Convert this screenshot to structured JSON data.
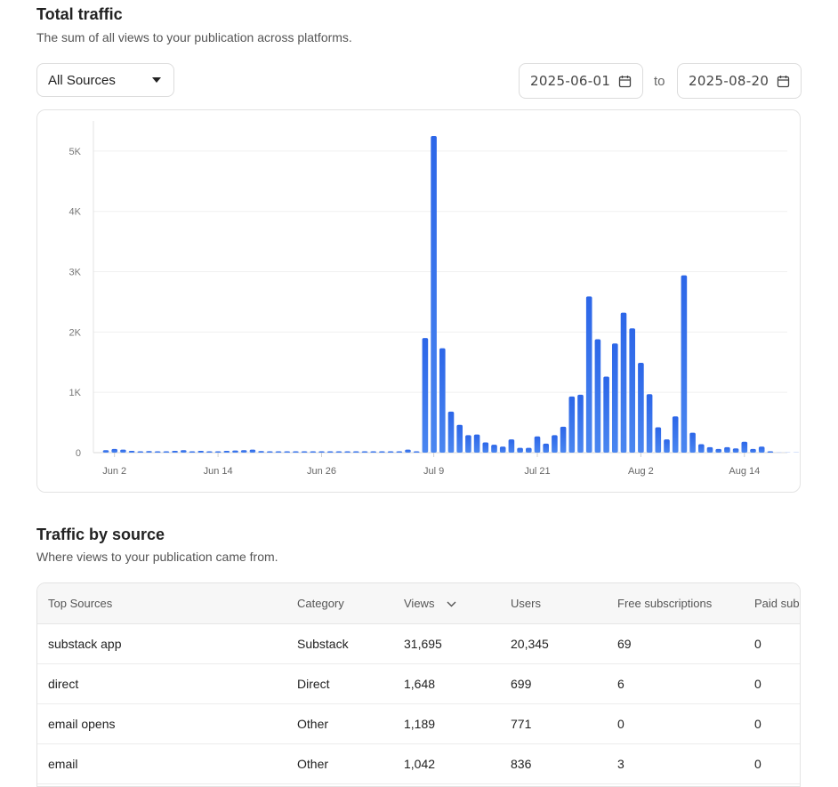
{
  "traffic": {
    "title": "Total traffic",
    "subtitle": "The sum of all views to your publication across platforms."
  },
  "filter": {
    "source_selected": "All Sources"
  },
  "dates": {
    "start": "2025-06-01",
    "to_label": "to",
    "end": "2025-08-20"
  },
  "chart_data": {
    "type": "bar",
    "title": "",
    "xlabel": "",
    "ylabel": "",
    "ylim": [
      0,
      5500
    ],
    "yticks": [
      0,
      1000,
      2000,
      3000,
      4000,
      5000
    ],
    "ytick_labels": [
      "0",
      "1K",
      "2K",
      "3K",
      "4K",
      "5K"
    ],
    "xtick_labels": [
      "Jun 2",
      "Jun 14",
      "Jun 26",
      "Jul 9",
      "Jul 21",
      "Aug 2",
      "Aug 14"
    ],
    "xtick_positions": [
      1,
      13,
      25,
      38,
      50,
      62,
      74
    ],
    "grid": true,
    "color": "#2f6ae6",
    "categories": [
      "Jun 1",
      "Jun 2",
      "Jun 3",
      "Jun 4",
      "Jun 5",
      "Jun 6",
      "Jun 7",
      "Jun 8",
      "Jun 9",
      "Jun 10",
      "Jun 11",
      "Jun 12",
      "Jun 13",
      "Jun 14",
      "Jun 15",
      "Jun 16",
      "Jun 17",
      "Jun 18",
      "Jun 19",
      "Jun 20",
      "Jun 21",
      "Jun 22",
      "Jun 23",
      "Jun 24",
      "Jun 25",
      "Jun 26",
      "Jun 27",
      "Jun 28",
      "Jun 29",
      "Jun 30",
      "Jul 1",
      "Jul 2",
      "Jul 3",
      "Jul 4",
      "Jul 5",
      "Jul 6",
      "Jul 7",
      "Jul 8",
      "Jul 9",
      "Jul 10",
      "Jul 11",
      "Jul 12",
      "Jul 13",
      "Jul 14",
      "Jul 15",
      "Jul 16",
      "Jul 17",
      "Jul 18",
      "Jul 19",
      "Jul 20",
      "Jul 21",
      "Jul 22",
      "Jul 23",
      "Jul 24",
      "Jul 25",
      "Jul 26",
      "Jul 27",
      "Jul 28",
      "Jul 29",
      "Jul 30",
      "Jul 31",
      "Aug 1",
      "Aug 2",
      "Aug 3",
      "Aug 4",
      "Aug 5",
      "Aug 6",
      "Aug 7",
      "Aug 8",
      "Aug 9",
      "Aug 10",
      "Aug 11",
      "Aug 12",
      "Aug 13",
      "Aug 14",
      "Aug 15",
      "Aug 16",
      "Aug 17",
      "Aug 18",
      "Aug 19",
      "Aug 20"
    ],
    "values": [
      40,
      60,
      50,
      30,
      20,
      25,
      10,
      20,
      30,
      40,
      20,
      30,
      20,
      10,
      30,
      35,
      40,
      50,
      25,
      20,
      15,
      10,
      10,
      5,
      10,
      5,
      5,
      5,
      5,
      5,
      10,
      10,
      20,
      15,
      20,
      50,
      20,
      1900,
      5250,
      1730,
      680,
      460,
      290,
      300,
      170,
      130,
      100,
      220,
      80,
      80,
      270,
      150,
      290,
      430,
      930,
      960,
      2590,
      1880,
      1260,
      1810,
      2320,
      2060,
      1490,
      970,
      420,
      220,
      600,
      2940,
      330,
      140,
      90,
      60,
      90,
      70,
      180,
      60,
      100,
      10,
      0,
      0,
      0
    ]
  },
  "source_section": {
    "title": "Traffic by source",
    "subtitle": "Where views to your publication came from."
  },
  "table": {
    "headers": [
      "Top Sources",
      "Category",
      "Views",
      "Users",
      "Free subscriptions",
      "Paid subs"
    ],
    "rows": [
      [
        "substack app",
        "Substack",
        "31,695",
        "20,345",
        "69",
        "0"
      ],
      [
        "direct",
        "Direct",
        "1,648",
        "699",
        "6",
        "0"
      ],
      [
        "email opens",
        "Other",
        "1,189",
        "771",
        "0",
        "0"
      ],
      [
        "email",
        "Other",
        "1,042",
        "836",
        "3",
        "0"
      ]
    ]
  }
}
